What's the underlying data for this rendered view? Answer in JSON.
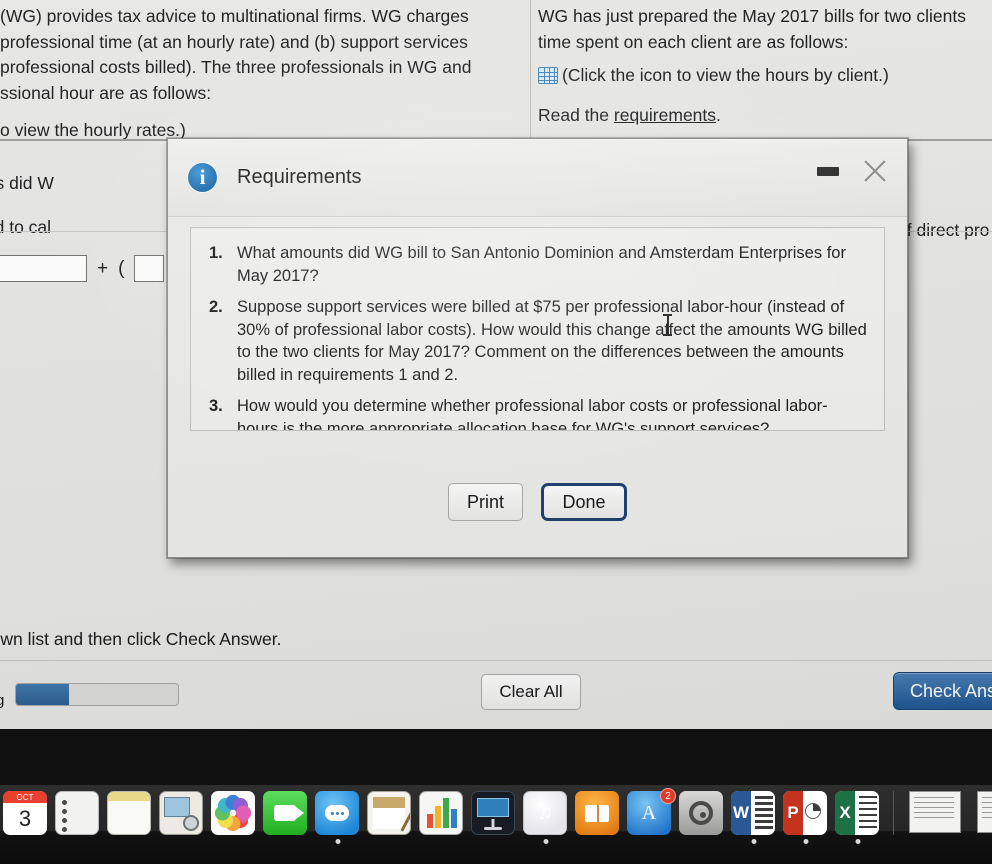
{
  "app": {
    "problem_left": {
      "lines": [
        "(WG) provides tax advice to multinational firms. WG charges",
        "professional time (at an hourly rate) and (b) support services",
        " professional costs billed). The three professionals in WG and",
        "ssional hour are as follows:",
        "o view the hourly rates.)"
      ],
      "question_fragment": "hat amounts did W",
      "formula_fragment": "nula needed to cal"
    },
    "problem_right": {
      "lines": [
        "WG has just prepared the May 2017 bills for two clients",
        "time spent on each client are as follows:"
      ],
      "table_hint": "(Click the icon to view the hours by client.)",
      "table_icon": "grid-table-icon",
      "read_prefix": "Read the ",
      "read_link": "requirements",
      "read_suffix": ".",
      "right_edge_fragment": "of direct pro"
    },
    "answer_row": {
      "operator_plus": "+",
      "operator_paren": "("
    },
    "bottom": {
      "instruction": "any drop-down list and then click Check Answer.",
      "progress_label": "g",
      "progress_percent": 33,
      "clear_all_label": "Clear All",
      "check_answer_label": "Check Ans"
    }
  },
  "dialog": {
    "title": "Requirements",
    "info_icon": "info-circle-icon",
    "minimize_icon": "minimize-icon",
    "close_icon": "close-x-icon",
    "requirements": [
      {
        "number": "1.",
        "text": "What amounts did WG bill to San Antonio Dominion and Amsterdam Enterprises for May 2017?"
      },
      {
        "number": "2.",
        "text": "Suppose support services were billed at $75 per professional labor-hour (instead of 30% of professional labor costs). How would this change affect the amounts WG billed to the two clients for May 2017? Comment on the differences between the amounts billed in requirements 1 and 2."
      },
      {
        "number": "3.",
        "text": "How would you determine whether professional labor costs or professional labor-hours is the more appropriate allocation base for WG's support services?"
      }
    ],
    "print_label": "Print",
    "done_label": "Done"
  },
  "dock": {
    "items": [
      {
        "name": "calendar",
        "label": "Calendar",
        "month": "OCT",
        "day": "3",
        "running": false
      },
      {
        "name": "reminders",
        "label": "Reminders",
        "running": false
      },
      {
        "name": "notes",
        "label": "Notes",
        "running": false
      },
      {
        "name": "preview",
        "label": "Preview",
        "running": false
      },
      {
        "name": "photos",
        "label": "Photos",
        "running": false
      },
      {
        "name": "facetime",
        "label": "FaceTime",
        "running": false
      },
      {
        "name": "messages",
        "label": "Messages",
        "running": true
      },
      {
        "name": "pages",
        "label": "Pages",
        "running": false
      },
      {
        "name": "numbers",
        "label": "Numbers",
        "running": false
      },
      {
        "name": "keynote",
        "label": "Keynote",
        "running": false
      },
      {
        "name": "itunes",
        "label": "iTunes",
        "running": true
      },
      {
        "name": "ibooks",
        "label": "iBooks",
        "running": false
      },
      {
        "name": "app-store",
        "label": "App Store",
        "badge": "2",
        "running": false
      },
      {
        "name": "system-preferences",
        "label": "System Preferences",
        "running": false
      },
      {
        "name": "word",
        "label": "Microsoft Word",
        "letter": "W",
        "running": true
      },
      {
        "name": "powerpoint",
        "label": "Microsoft PowerPoint",
        "letter": "P",
        "running": true
      },
      {
        "name": "excel",
        "label": "Microsoft Excel",
        "letter": "X",
        "running": true
      }
    ],
    "minimized": [
      {
        "name": "minimized-window-1"
      },
      {
        "name": "minimized-window-2"
      },
      {
        "name": "minimized-window-3"
      },
      {
        "name": "minimized-window-4"
      }
    ]
  },
  "colors": {
    "accent_blue": "#2f6ba5",
    "info_blue": "#1565a8",
    "default_button_ring": "#1d3f6e",
    "app_background": "#e6e6e4",
    "dialog_background": "#ececea"
  }
}
